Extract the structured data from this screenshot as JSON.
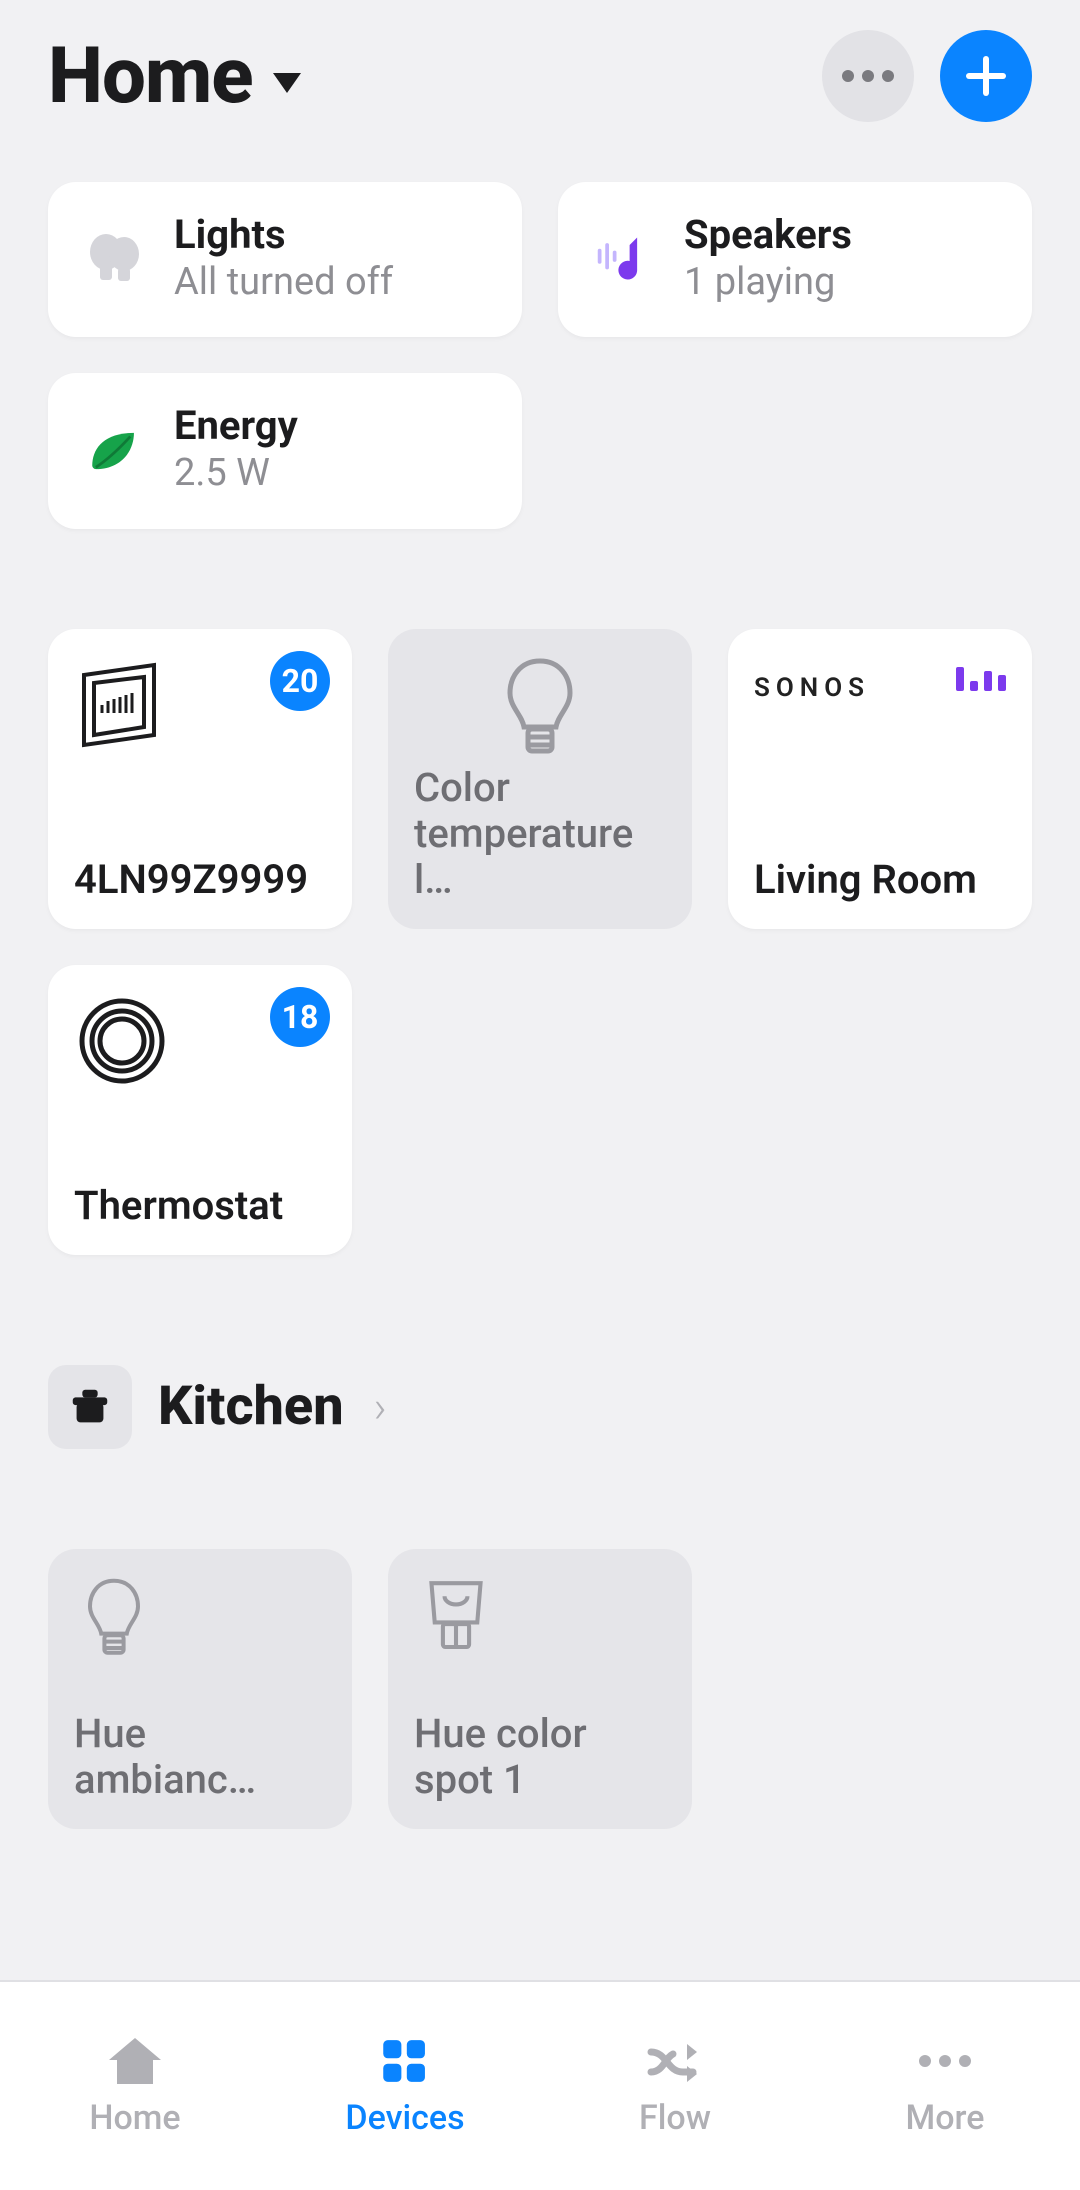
{
  "header": {
    "title": "Home"
  },
  "summary": {
    "lights": {
      "title": "Lights",
      "status": "All turned off"
    },
    "speakers": {
      "title": "Speakers",
      "status": "1 playing"
    },
    "energy": {
      "title": "Energy",
      "status": "2.5 W"
    }
  },
  "favorites": [
    {
      "label": "4LN99Z9999",
      "badge": "20",
      "type": "sensor-display",
      "state": "on"
    },
    {
      "label": "Color temperature l…",
      "type": "bulb",
      "state": "off"
    },
    {
      "label": "Living Room",
      "type": "sonos",
      "brand": "SONOS",
      "state": "on"
    },
    {
      "label": "Thermostat",
      "badge": "18",
      "type": "thermostat",
      "state": "on"
    }
  ],
  "rooms": [
    {
      "name": "Kitchen",
      "devices": [
        {
          "label": "Hue ambianc…",
          "type": "bulb",
          "state": "off"
        },
        {
          "label": "Hue color spot 1",
          "type": "spot",
          "state": "off"
        }
      ]
    }
  ],
  "nav": {
    "items": [
      {
        "label": "Home"
      },
      {
        "label": "Devices"
      },
      {
        "label": "Flow"
      },
      {
        "label": "More"
      }
    ],
    "active": 1
  },
  "colors": {
    "accent": "#0a84ff",
    "music": "#7c3aed",
    "leaf": "#22c55e"
  }
}
